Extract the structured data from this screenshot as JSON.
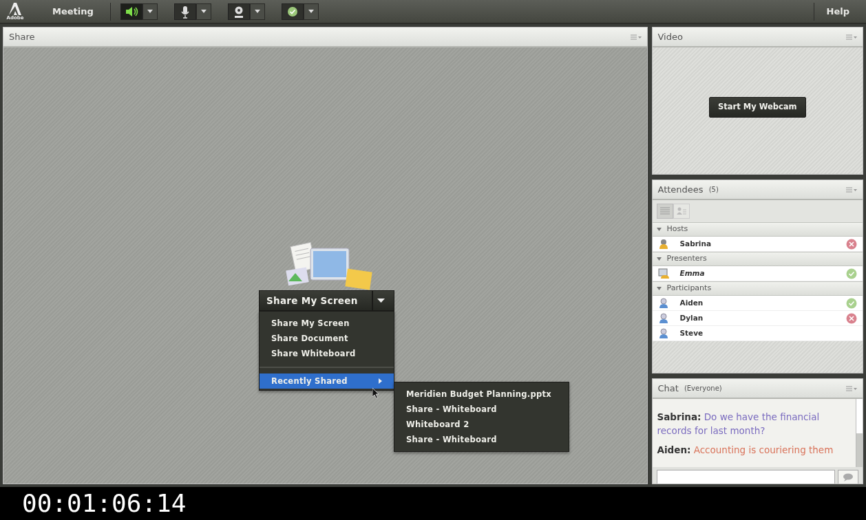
{
  "top_bar": {
    "logo_text": "Adobe",
    "menu": "Meeting",
    "tools": [
      {
        "kind": "speaker",
        "active": true
      },
      {
        "kind": "microphone",
        "active": false
      },
      {
        "kind": "webcam",
        "active": false
      },
      {
        "kind": "status",
        "active": false
      }
    ],
    "help": "Help"
  },
  "share": {
    "title": "Share",
    "button": "Share My Screen",
    "menu": [
      {
        "label": "Share My Screen",
        "selected": false,
        "submenu": false
      },
      {
        "label": "Share Document",
        "selected": false,
        "submenu": false
      },
      {
        "label": "Share Whiteboard",
        "selected": false,
        "submenu": false
      },
      {
        "label": "Recently Shared",
        "selected": true,
        "submenu": true
      }
    ],
    "recent": [
      "Meridien Budget  Planning.pptx",
      "Share - Whiteboard",
      "Whiteboard 2",
      "Share - Whiteboard"
    ]
  },
  "video": {
    "title": "Video",
    "button": "Start My Webcam"
  },
  "attendees": {
    "title": "Attendees",
    "count": "(5)",
    "groups": [
      {
        "label": "Hosts",
        "expanded": true,
        "people": [
          {
            "name": "Sabrina",
            "kind": "host",
            "agree": false,
            "disagree": true
          }
        ]
      },
      {
        "label": "Presenters",
        "expanded": true,
        "people": [
          {
            "name": "Emma",
            "kind": "presenter",
            "agree": true,
            "disagree": false
          }
        ]
      },
      {
        "label": "Participants",
        "expanded": true,
        "people": [
          {
            "name": "Aiden",
            "kind": "participant",
            "agree": true,
            "disagree": false
          },
          {
            "name": "Dylan",
            "kind": "participant",
            "agree": false,
            "disagree": true
          },
          {
            "name": "Steve",
            "kind": "participant",
            "agree": false,
            "disagree": false
          }
        ]
      }
    ]
  },
  "chat": {
    "title": "Chat",
    "scope": "(Everyone)",
    "messages": [
      {
        "sender": "Sabrina:",
        "text": "Do we have the financial records for last month?",
        "color": "#7a6bbf"
      },
      {
        "sender": "Aiden:",
        "text": "Accounting is couriering them",
        "color": "#d9735a"
      }
    ]
  },
  "timecode": "00:01:06:14"
}
